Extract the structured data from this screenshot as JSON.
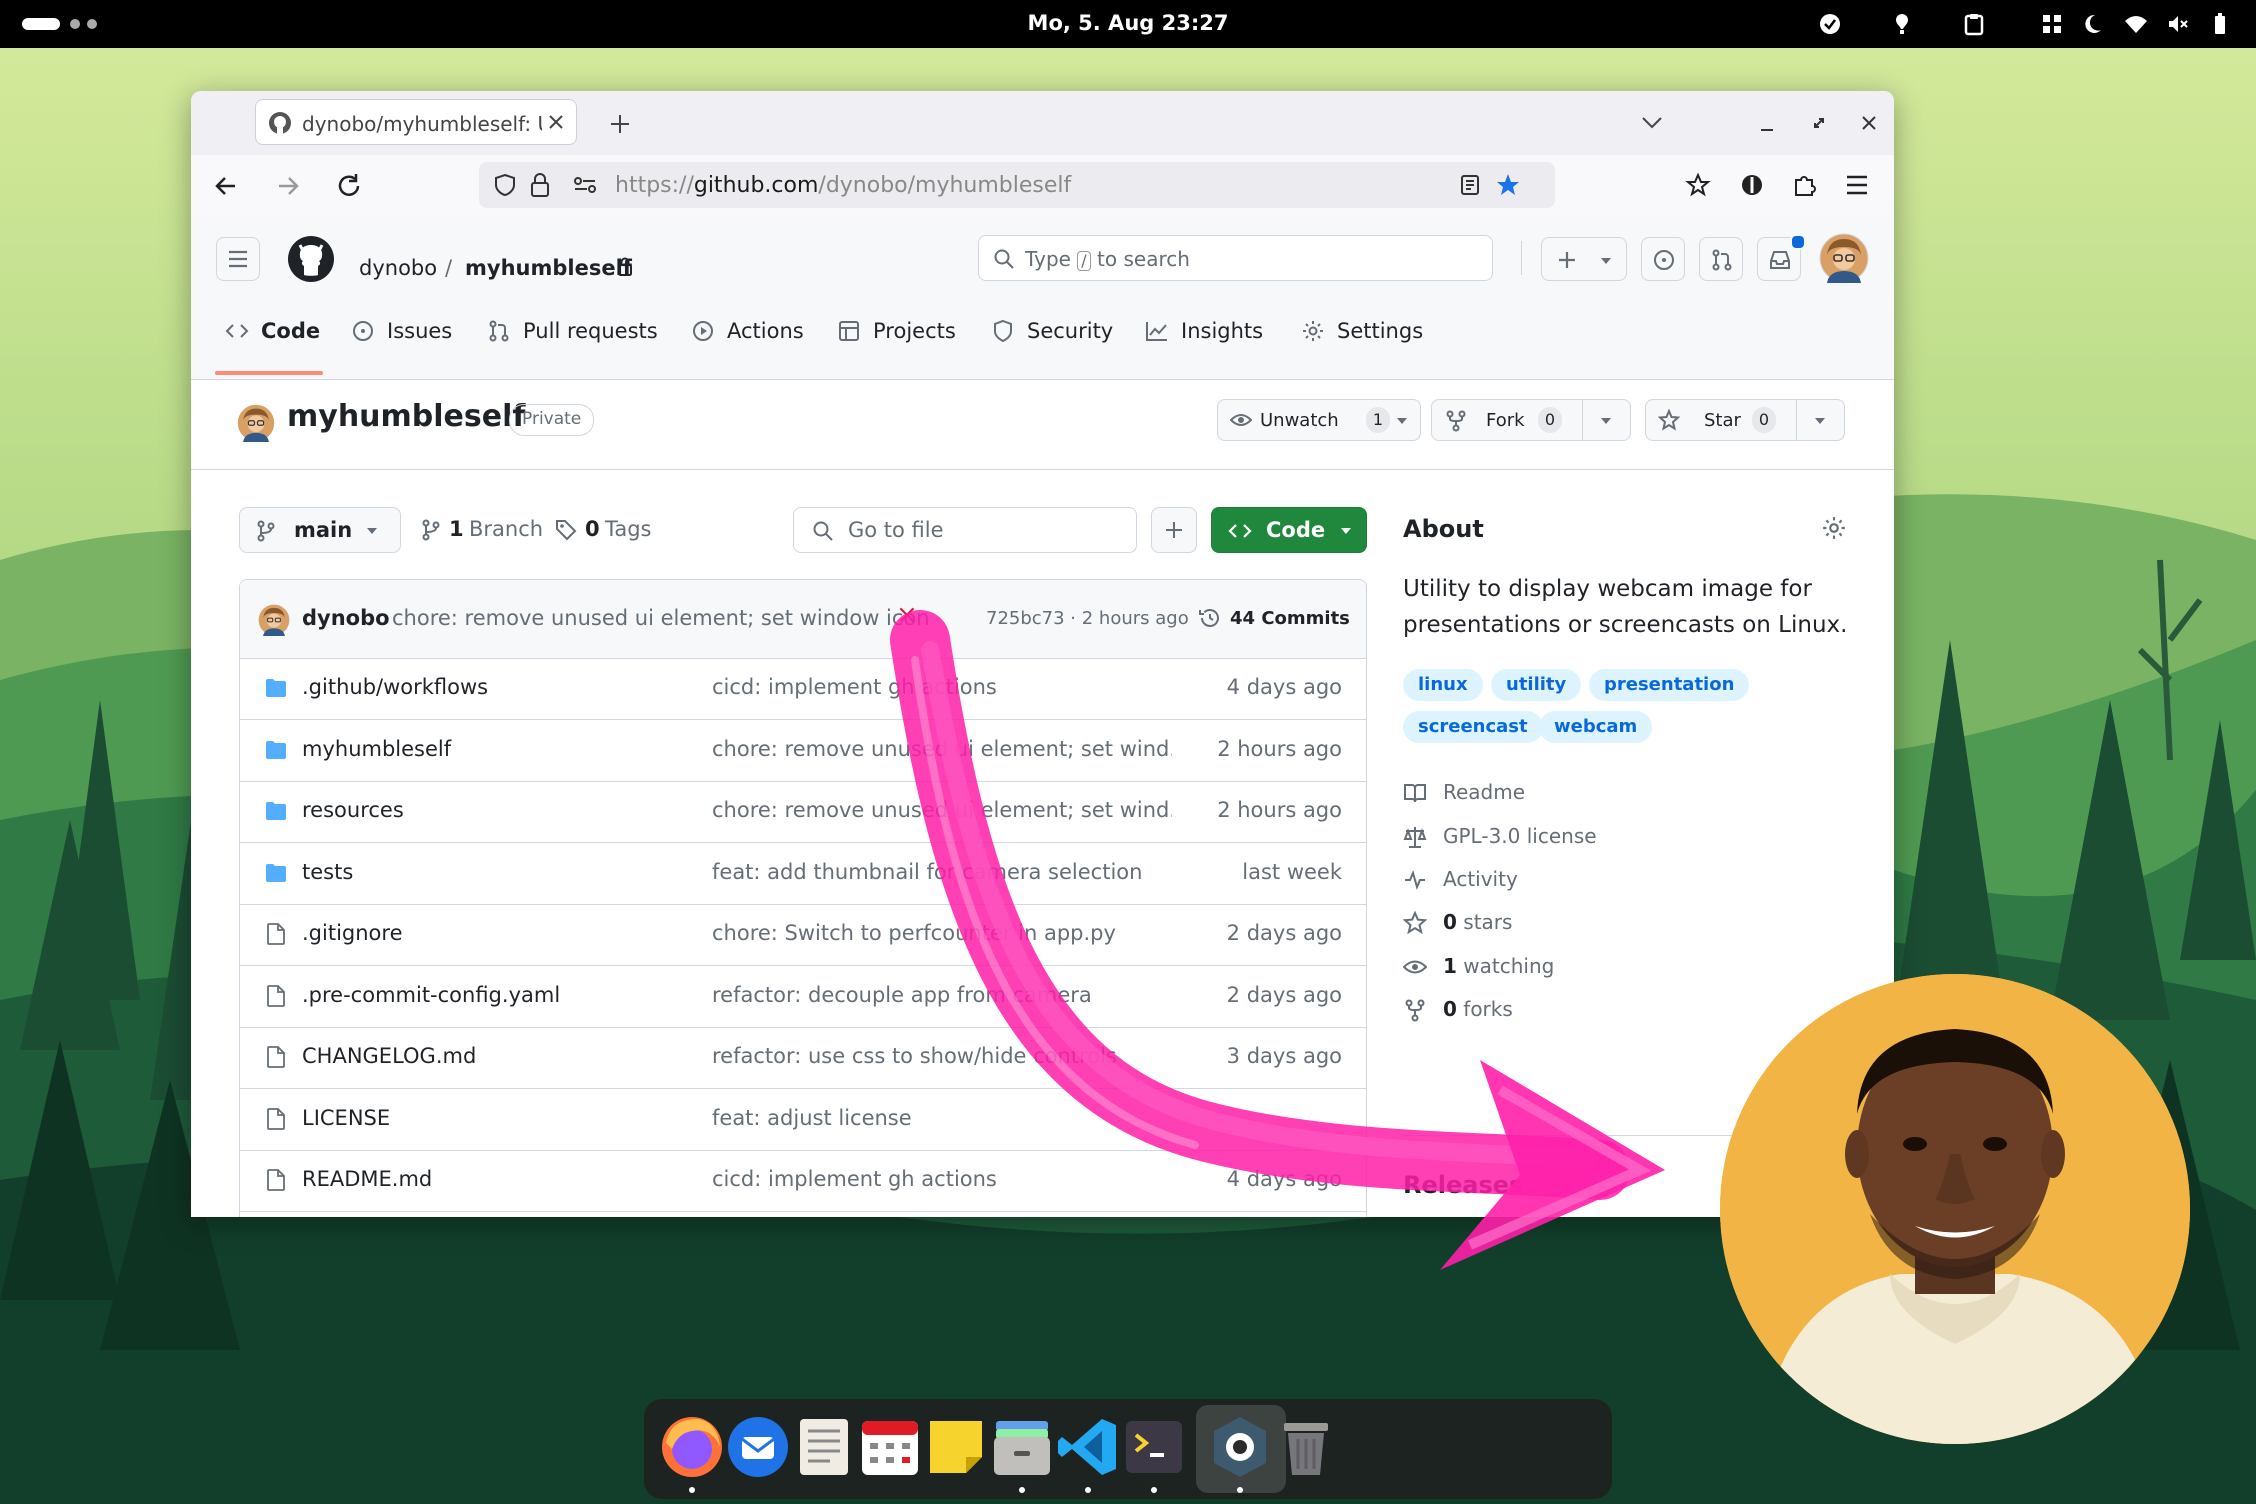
{
  "topbar": {
    "clock": "Mo, 5. Aug  23:27"
  },
  "browser": {
    "tab_title": "dynobo/myhumbleself: U",
    "url_prefix": "https://",
    "url_domain": "github.com",
    "url_path": "/dynobo/myhumbleself"
  },
  "github": {
    "owner": "dynobo",
    "separator": "/",
    "repo": "myhumbleself",
    "search_placeholder_pre": "Type",
    "search_key": "/",
    "search_placeholder_post": "to search",
    "nav": [
      {
        "label": "Code",
        "icon": "code-icon"
      },
      {
        "label": "Issues",
        "icon": "issue-icon"
      },
      {
        "label": "Pull requests",
        "icon": "pull-request-icon"
      },
      {
        "label": "Actions",
        "icon": "play-icon"
      },
      {
        "label": "Projects",
        "icon": "table-icon"
      },
      {
        "label": "Security",
        "icon": "shield-icon"
      },
      {
        "label": "Insights",
        "icon": "graph-icon"
      },
      {
        "label": "Settings",
        "icon": "gear-icon"
      }
    ],
    "repo_title": "myhumbleself",
    "visibility": "Private",
    "actions": {
      "unwatch_label": "Unwatch",
      "unwatch_count": "1",
      "fork_label": "Fork",
      "fork_count": "0",
      "star_label": "Star",
      "star_count": "0"
    },
    "branch": "main",
    "branch_count": "1",
    "branch_label": "Branch",
    "tag_count": "0",
    "tag_label": "Tags",
    "goto_file": "Go to file",
    "code_button": "Code",
    "latest_commit": {
      "author": "dynobo",
      "message": "chore: remove unused ui element; set window icon",
      "status": "×",
      "hash_time": "725bc73 · 2 hours ago",
      "commits": "44 Commits"
    },
    "files": [
      {
        "name": ".github/workflows",
        "type": "folder",
        "message": "cicd: implement gh actions",
        "date": "4 days ago"
      },
      {
        "name": "myhumbleself",
        "type": "folder",
        "message": "chore: remove unused ui element; set wind...",
        "date": "2 hours ago"
      },
      {
        "name": "resources",
        "type": "folder",
        "message": "chore: remove unused ui element; set wind...",
        "date": "2 hours ago"
      },
      {
        "name": "tests",
        "type": "folder",
        "message": "feat: add thumbnail for camera selection",
        "date": "last week"
      },
      {
        "name": ".gitignore",
        "type": "file",
        "message": "chore: Switch to perfcounter in app.py",
        "date": "2 days ago"
      },
      {
        "name": ".pre-commit-config.yaml",
        "type": "file",
        "message": "refactor: decouple app from camera",
        "date": "2 days ago"
      },
      {
        "name": "CHANGELOG.md",
        "type": "file",
        "message": "refactor: use css to show/hide controls",
        "date": "3 days ago"
      },
      {
        "name": "LICENSE",
        "type": "file",
        "message": "feat: adjust license",
        "date": ""
      },
      {
        "name": "README.md",
        "type": "file",
        "message": "cicd: implement gh actions",
        "date": "4 days ago"
      }
    ],
    "about": {
      "title": "About",
      "description": "Utility to display webcam image for presentations or screencasts on Linux.",
      "topics": [
        "linux",
        "utility",
        "presentation",
        "screencast",
        "webcam"
      ],
      "items": [
        {
          "label": "Readme",
          "icon": "book-icon",
          "bold": ""
        },
        {
          "label": "GPL-3.0 license",
          "icon": "law-icon",
          "bold": ""
        },
        {
          "label": "Activity",
          "icon": "pulse-icon",
          "bold": ""
        },
        {
          "label": "stars",
          "icon": "star-icon",
          "bold": "0"
        },
        {
          "label": "watching",
          "icon": "eye-icon",
          "bold": "1"
        },
        {
          "label": "forks",
          "icon": "fork-icon",
          "bold": "0"
        }
      ],
      "releases_title": "Releases"
    }
  },
  "colors": {
    "accent_green": "#1f883d",
    "link_blue": "#0969da",
    "arrow_pink": "#ff1fa8",
    "webcam_bg": "#f2b545",
    "nav_active_underline": "#fd8c73"
  },
  "dock": {
    "apps": [
      "firefox-icon",
      "thunderbird-icon",
      "text-editor-icon",
      "calendar-icon",
      "notes-icon",
      "files-icon",
      "vscode-icon",
      "terminal-icon",
      "webcam-app-icon",
      "trash-icon"
    ]
  }
}
